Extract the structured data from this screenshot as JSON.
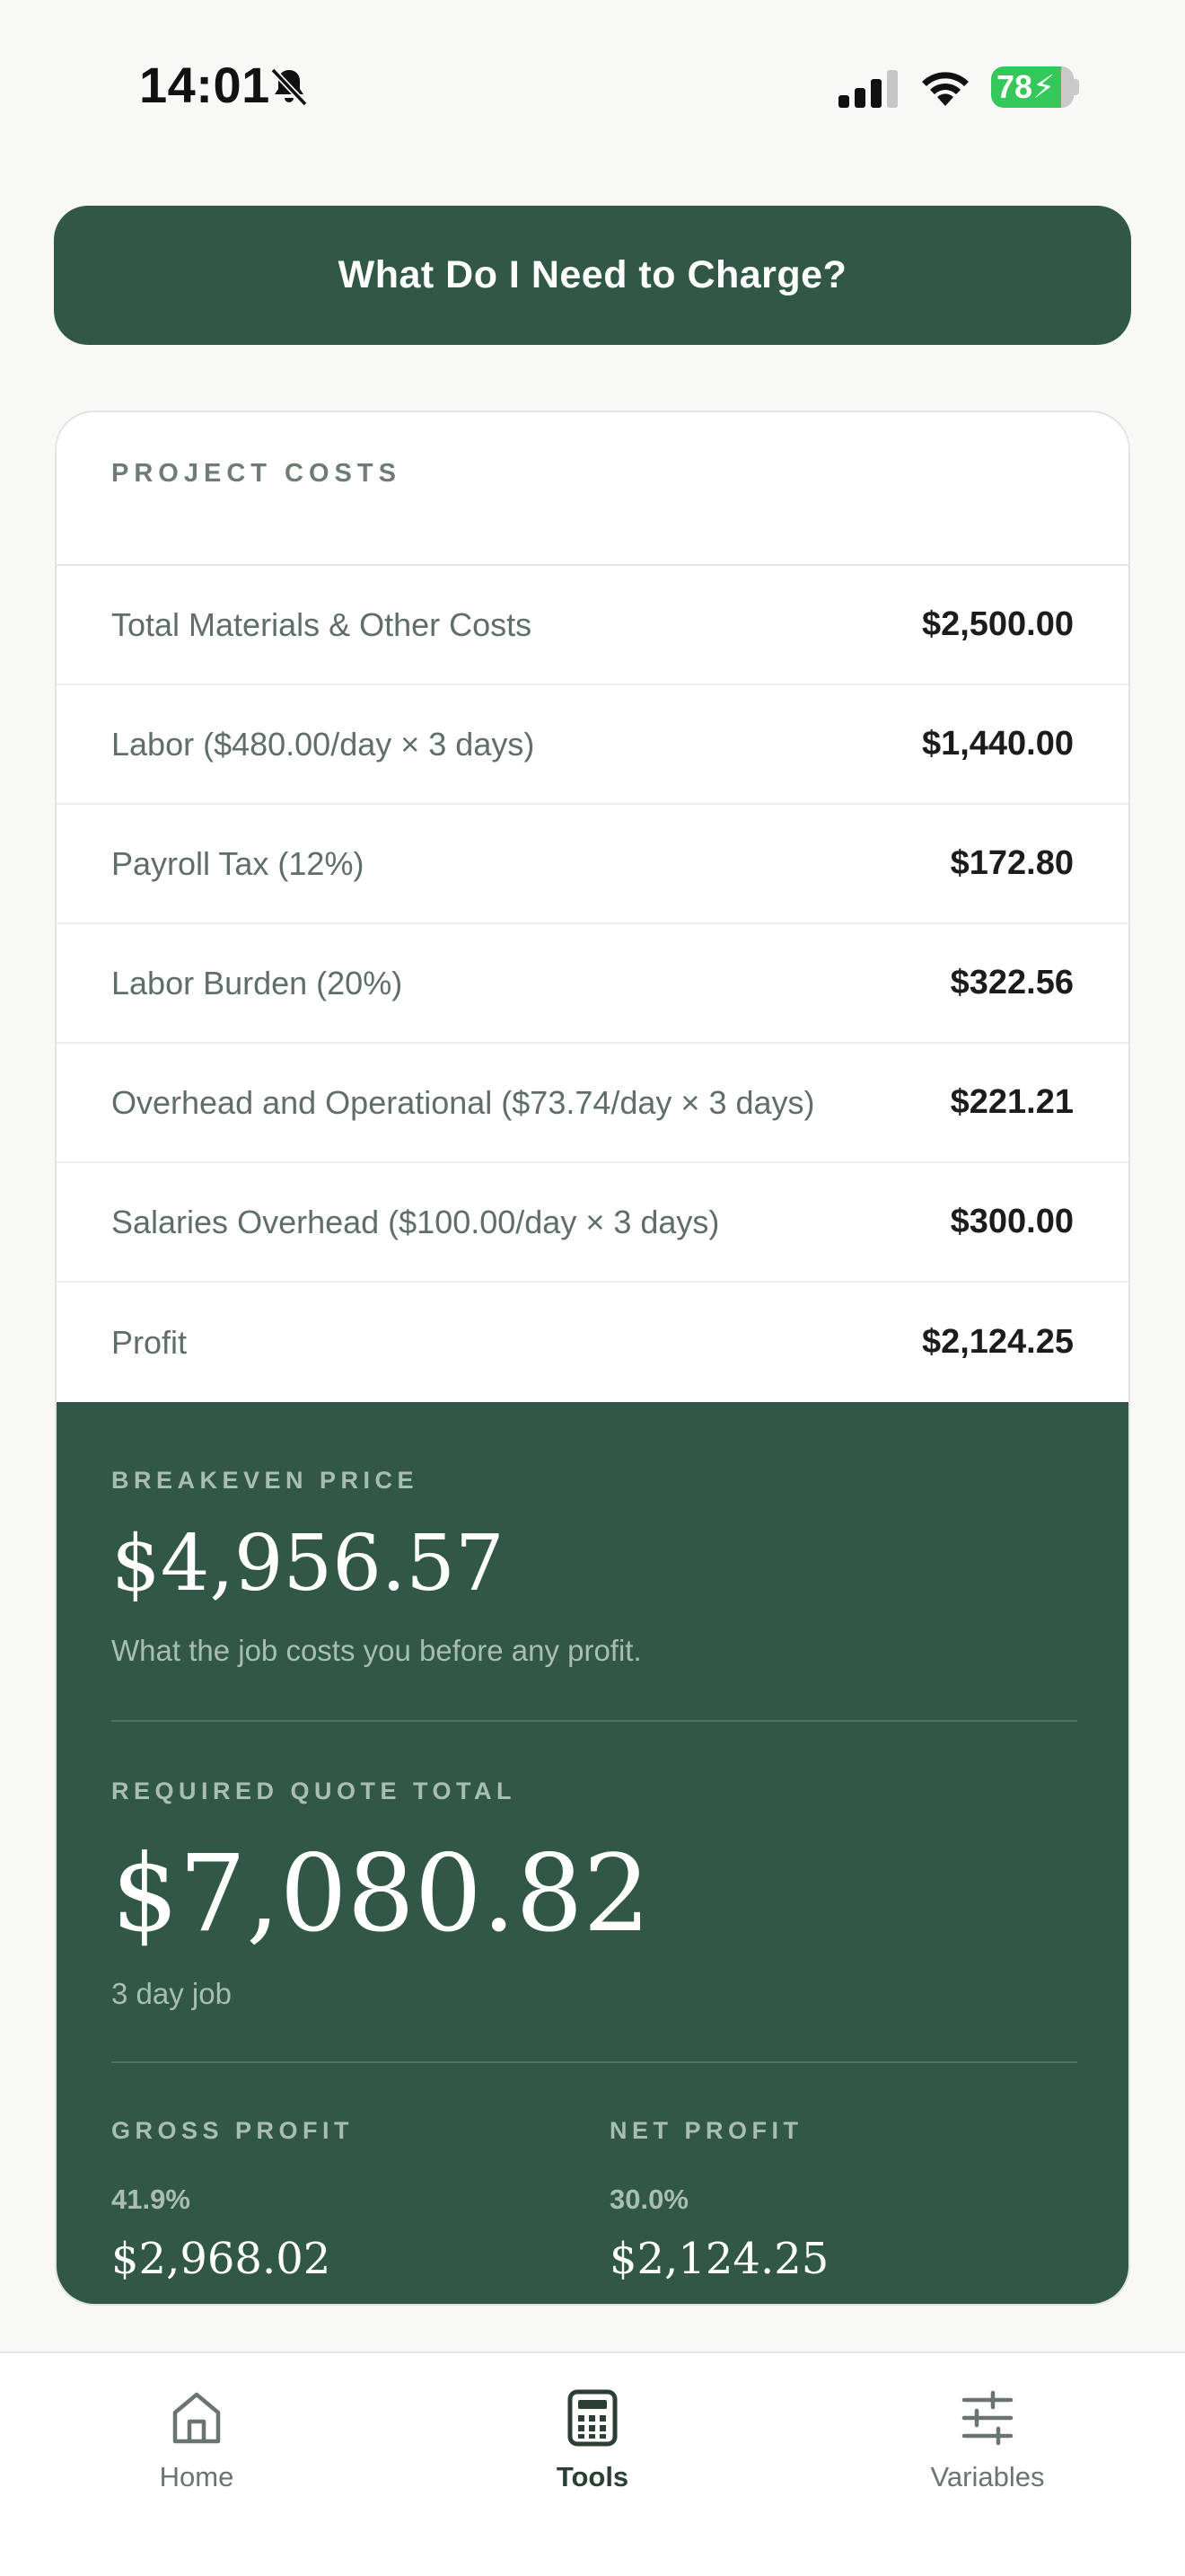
{
  "status_bar": {
    "time": "14:01",
    "battery": "78"
  },
  "header": {
    "button_label": "What Do I Need to Charge?"
  },
  "project_costs": {
    "title": "PROJECT COSTS",
    "rows": [
      {
        "label": "Total Materials & Other Costs",
        "value": "$2,500.00"
      },
      {
        "label": "Labor ($480.00/day × 3 days)",
        "value": "$1,440.00"
      },
      {
        "label": "Payroll Tax (12%)",
        "value": "$172.80"
      },
      {
        "label": "Labor Burden (20%)",
        "value": "$322.56"
      },
      {
        "label": "Overhead and Operational ($73.74/day × 3 days)",
        "value": "$221.21"
      },
      {
        "label": "Salaries Overhead ($100.00/day × 3 days)",
        "value": "$300.00"
      },
      {
        "label": "Profit",
        "value": "$2,124.25"
      }
    ]
  },
  "summary": {
    "breakeven_label": "BREAKEVEN PRICE",
    "breakeven_value": "$4,956.57",
    "breakeven_note": "What the job costs you before any profit.",
    "quote_label": "REQUIRED QUOTE TOTAL",
    "quote_value": "$7,080.82",
    "quote_note": "3 day job",
    "gross_profit_label": "GROSS PROFIT",
    "gross_profit_pct": "41.9%",
    "gross_profit_value": "$2,968.02",
    "net_profit_label": "NET PROFIT",
    "net_profit_pct": "30.0%",
    "net_profit_value": "$2,124.25"
  },
  "tab_bar": {
    "tabs": [
      {
        "label": "Home",
        "icon": "home-icon",
        "active": false
      },
      {
        "label": "Tools",
        "icon": "calculator-icon",
        "active": true
      },
      {
        "label": "Variables",
        "icon": "sliders-icon",
        "active": false
      }
    ]
  },
  "colors": {
    "primary_green": "#315846",
    "battery_green": "#34c759",
    "muted_text": "#5f6e66"
  }
}
